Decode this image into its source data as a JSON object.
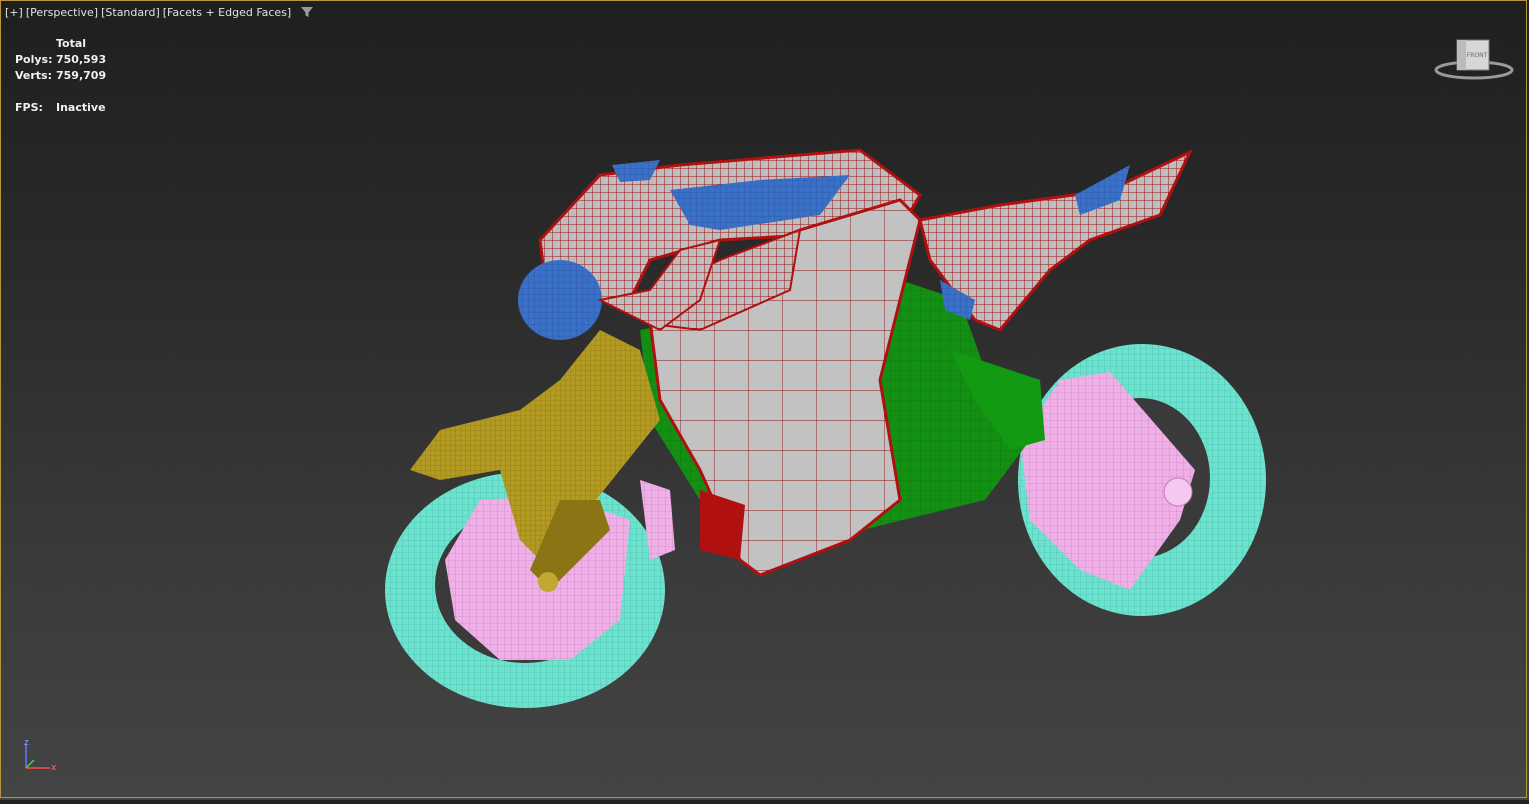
{
  "viewport": {
    "labels": [
      "[+]",
      "[Perspective]",
      "[Standard]",
      "[Facets + Edged Faces]"
    ],
    "filter_icon": "filter-icon"
  },
  "stats": {
    "header": "Total",
    "polys_label": "Polys:",
    "polys_value": "750,593",
    "verts_label": "Verts:",
    "verts_value": "759,709",
    "fps_label": "FPS:",
    "fps_value": "Inactive"
  },
  "viewcube": {
    "face_label": "FRONT",
    "icon": "viewcube-icon"
  },
  "axis_tripod": {
    "z": "z",
    "x": "x"
  },
  "colors": {
    "frame_border": "#b8963c",
    "body_red": "#b01010",
    "body_grey": "#bdbdbd",
    "frame_green": "#129012",
    "fork_gold": "#b39a22",
    "tire_cyan": "#6de3cf",
    "wheel_pink": "#eeb0e6",
    "part_blue": "#3a70c8"
  }
}
